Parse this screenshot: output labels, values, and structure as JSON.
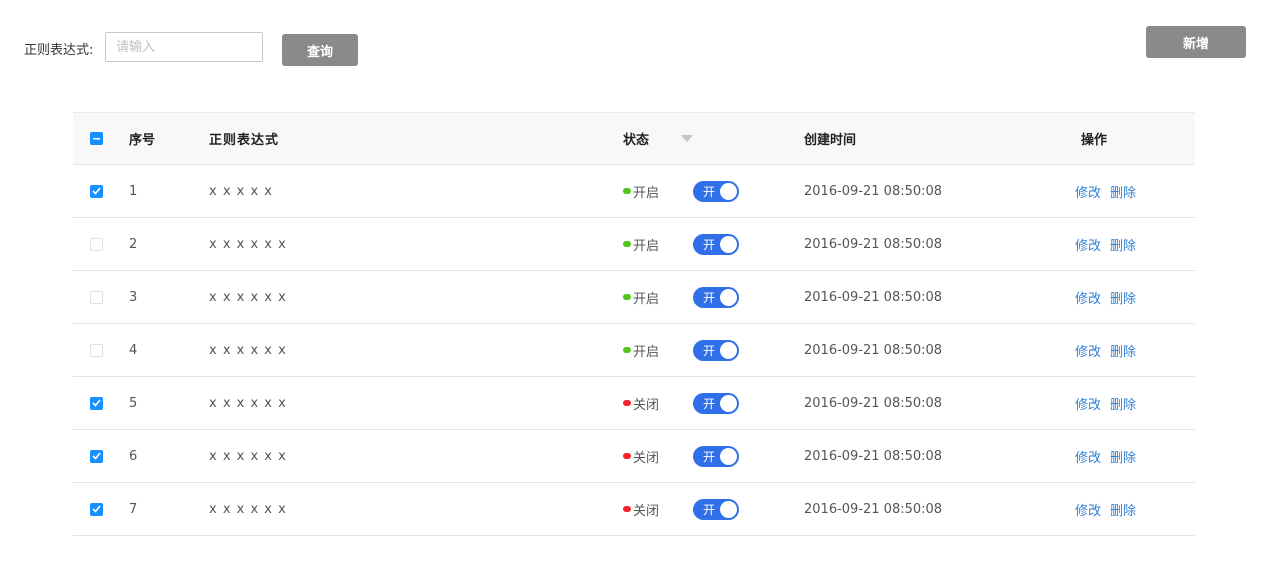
{
  "toolbar": {
    "label": "正则表达式:",
    "search_placeholder": "请输入",
    "search_value": "",
    "query_label": "查询",
    "add_label": "新增"
  },
  "table": {
    "headers": {
      "seq": "序号",
      "regex": "正则表达式",
      "status": "状态",
      "created": "创建时间",
      "ops": "操作"
    },
    "header_checkbox_state": "indeterminate",
    "rows": [
      {
        "checked": true,
        "seq": "1",
        "regex": "x x x x x",
        "status": "开启",
        "status_color": "#52c41a",
        "toggle_label": "开",
        "toggle_on": true,
        "created": "2016-09-21  08:50:08",
        "edit": "修改",
        "delete": "删除"
      },
      {
        "checked": false,
        "seq": "2",
        "regex": "x x x x x x",
        "status": "开启",
        "status_color": "#52c41a",
        "toggle_label": "开",
        "toggle_on": true,
        "created": "2016-09-21  08:50:08",
        "edit": "修改",
        "delete": "删除"
      },
      {
        "checked": false,
        "seq": "3",
        "regex": "x x x x x x",
        "status": "开启",
        "status_color": "#52c41a",
        "toggle_label": "开",
        "toggle_on": true,
        "created": "2016-09-21  08:50:08",
        "edit": "修改",
        "delete": "删除"
      },
      {
        "checked": false,
        "seq": "4",
        "regex": "x x x x x x",
        "status": "开启",
        "status_color": "#52c41a",
        "toggle_label": "开",
        "toggle_on": true,
        "created": "2016-09-21  08:50:08",
        "edit": "修改",
        "delete": "删除"
      },
      {
        "checked": true,
        "seq": "5",
        "regex": "x x x x x x",
        "status": "关闭",
        "status_color": "#f5222d",
        "toggle_label": "开",
        "toggle_on": true,
        "created": "2016-09-21  08:50:08",
        "edit": "修改",
        "delete": "删除"
      },
      {
        "checked": true,
        "seq": "6",
        "regex": "x x x x x x",
        "status": "关闭",
        "status_color": "#f5222d",
        "toggle_label": "开",
        "toggle_on": true,
        "created": "2016-09-21  08:50:08",
        "edit": "修改",
        "delete": "删除"
      },
      {
        "checked": true,
        "seq": "7",
        "regex": "x x x x x x",
        "status": "关闭",
        "status_color": "#f5222d",
        "toggle_label": "开",
        "toggle_on": true,
        "created": "2016-09-21  08:50:08",
        "edit": "修改",
        "delete": "删除"
      }
    ]
  },
  "icons": {
    "filter": "filter-icon",
    "check": "check-icon",
    "minus": "minus-icon"
  },
  "colors": {
    "primary": "#1890ff",
    "switch": "#2f6fe8",
    "link": "#2f7fd6",
    "button_gray": "#8a8a8a"
  }
}
